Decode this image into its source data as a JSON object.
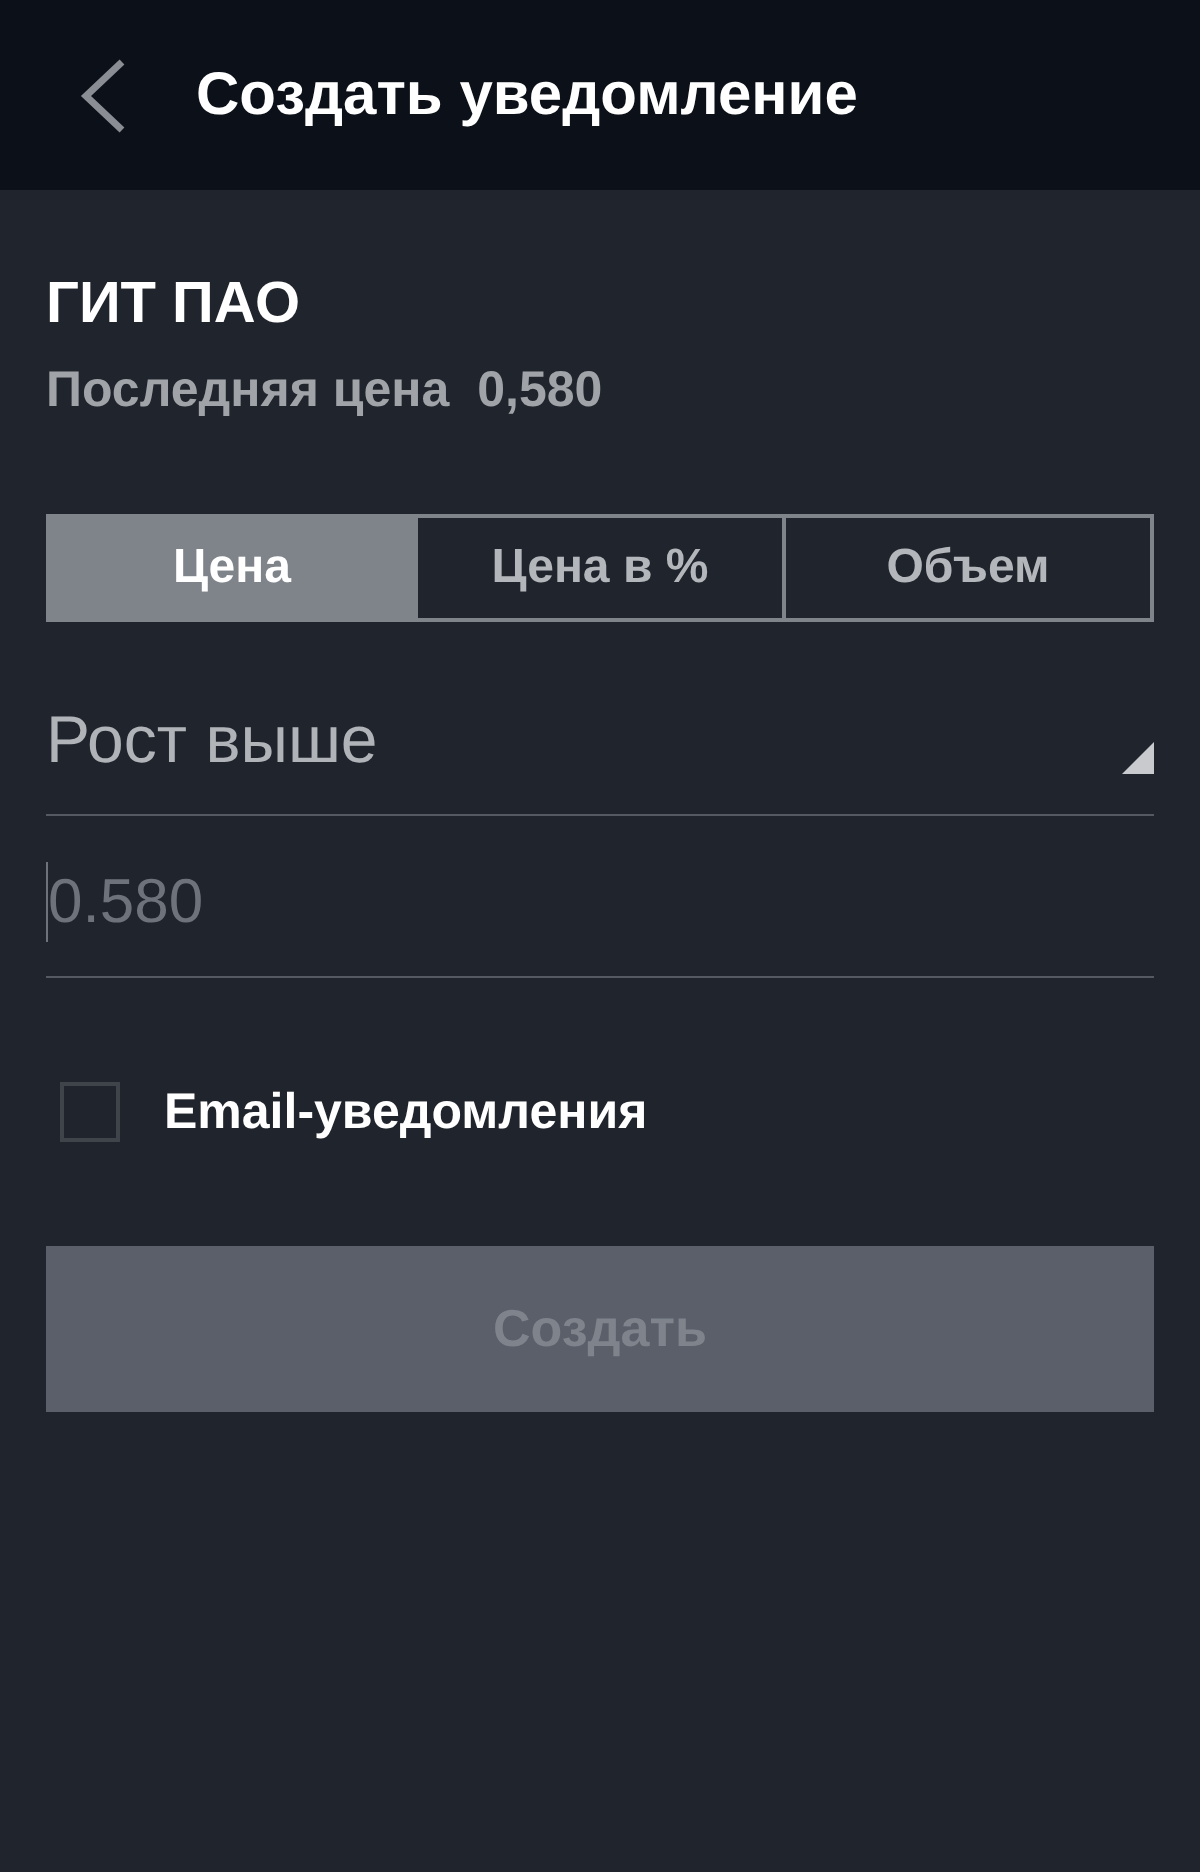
{
  "header": {
    "title": "Создать уведомление"
  },
  "instrument": {
    "name": "ГИТ ПАО",
    "last_price_label": "Последняя цена",
    "last_price": "0,580"
  },
  "tabs": [
    {
      "label": "Цена",
      "selected": true
    },
    {
      "label": "Цена в %",
      "selected": false
    },
    {
      "label": "Объем",
      "selected": false
    }
  ],
  "condition": {
    "value": "Рост выше"
  },
  "price_input": {
    "placeholder": "0.580",
    "focused": true
  },
  "email_notifications": {
    "label": "Email-уведомления",
    "checked": false
  },
  "create_button": {
    "label": "Создать",
    "disabled": true
  }
}
